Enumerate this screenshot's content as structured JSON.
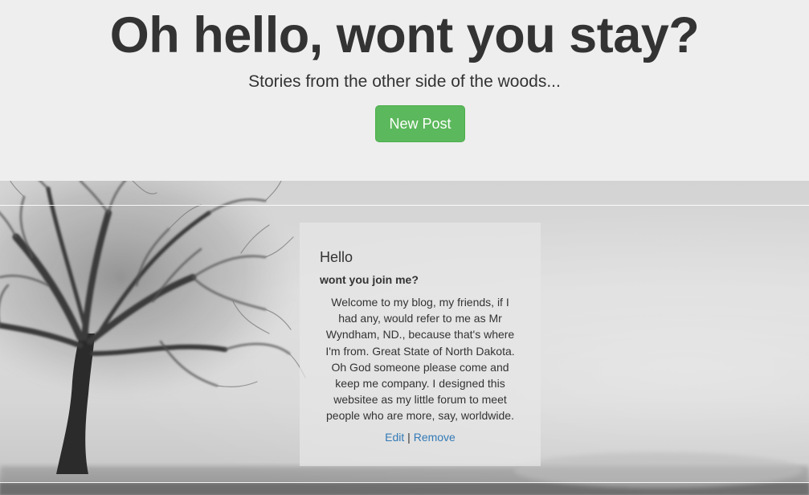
{
  "header": {
    "title": "Oh hello, wont you stay?",
    "subtitle": "Stories from the other side of the woods...",
    "new_post_label": "New Post"
  },
  "post": {
    "title": "Hello",
    "subtitle": "wont you join me?",
    "body": "Welcome to my blog, my friends, if I had any, would refer to me as Mr Wyndham, ND., because that's where I'm from. Great State of North Dakota. Oh God someone please come and keep me company. I designed this websitee as my little forum to meet people who are more, say, worldwide.",
    "edit_label": "Edit",
    "separator": "|",
    "remove_label": "Remove"
  },
  "colors": {
    "jumbotron_bg": "#eeeeee",
    "text": "#333333",
    "button_bg": "#5cb85c",
    "link": "#337ab7"
  },
  "background_image": "foggy-tree"
}
